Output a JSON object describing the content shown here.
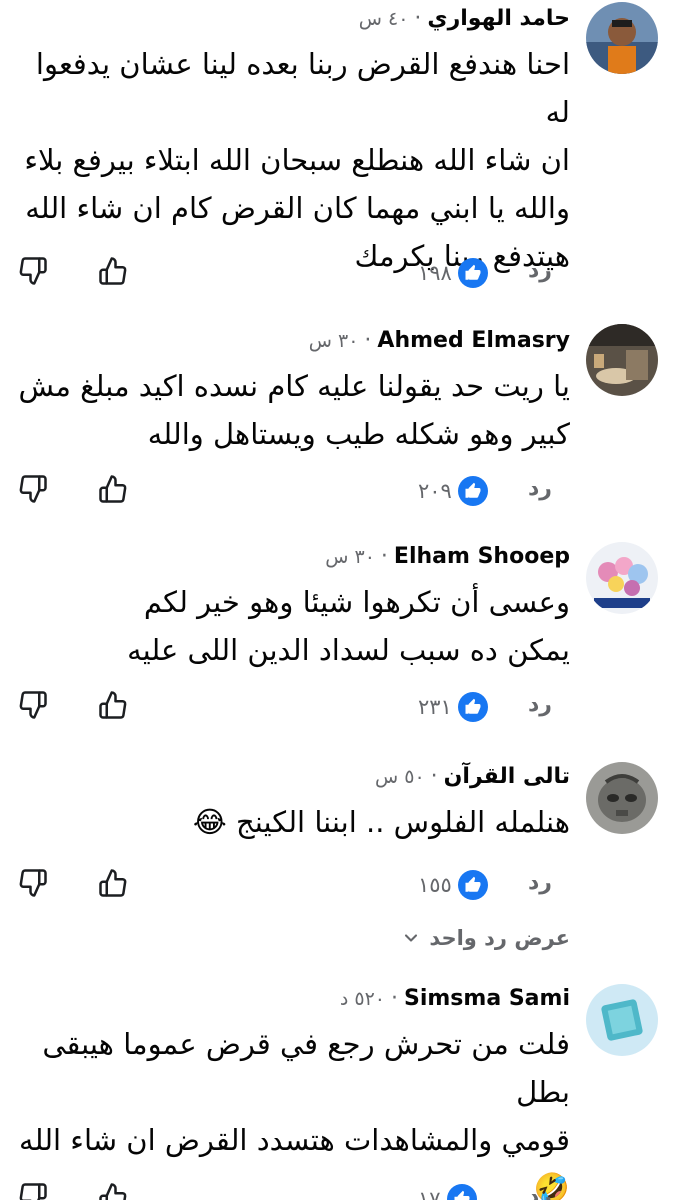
{
  "comments": [
    {
      "author": "حامد الهواري",
      "time": "٤٠ س",
      "lines": [
        "احنا هندفع القرض ربنا بعده لينا عشان يدفعوا له",
        "ان شاء الله هنطلع سبحان الله ابتلاء بيرفع بلاء",
        "والله يا ابني مهما كان القرض كام ان شاء الله",
        "هيتدفع ربنا يكرمك"
      ],
      "reply_label": "رد",
      "reaction_count": "١٩٨"
    },
    {
      "author": "Ahmed Elmasry",
      "time": "٣٠ س",
      "lines": [
        "يا ريت حد يقولنا عليه كام نسده اكيد مبلغ مش",
        "كبير وهو شكله طيب ويستاهل والله"
      ],
      "reply_label": "رد",
      "reaction_count": "٢٠٩"
    },
    {
      "author": "Elham Shooep",
      "time": "٣٠ س",
      "lines": [
        "وعسى أن تكرهوا شيئا وهو خير لكم",
        "يمكن ده سبب لسداد الدين اللى عليه"
      ],
      "reply_label": "رد",
      "reaction_count": "٢٣١"
    },
    {
      "author": "تالى القرآن",
      "time": "٥٠ س",
      "lines": [
        "هنلمله الفلوس .. ابننا الكينج 😂"
      ],
      "reply_label": "رد",
      "reaction_count": "١٥٥"
    },
    {
      "author": "Simsma Sami",
      "time": "٥٢٠ د",
      "lines": [
        "فلت من تحرش رجع في قرض عموما هيبقى بطل",
        "قومي والمشاهدات هتسدد القرض ان شاء الله 🤣",
        "🤣🤣"
      ],
      "reply_label": "رد",
      "reaction_count": "١٧"
    }
  ],
  "view_replies_label": "عرض رد واحد",
  "icons": {
    "like": "thumbs-up-icon",
    "dislike": "thumbs-down-icon",
    "reaction": "like-reaction-icon",
    "chevron": "chevron-down-icon"
  },
  "colors": {
    "like_blue": "#1877f2",
    "secondary_text": "#65676b"
  }
}
